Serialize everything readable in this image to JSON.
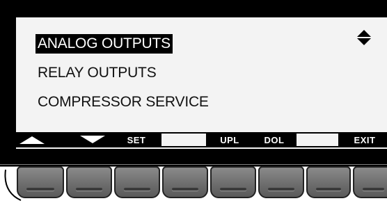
{
  "menu": {
    "items": [
      {
        "label": "ANALOG OUTPUTS",
        "selected": true
      },
      {
        "label": "RELAY OUTPUTS",
        "selected": false
      },
      {
        "label": "COMPRESSOR SERVICE",
        "selected": false
      }
    ],
    "scroll_icon": "up-down-triangles-icon"
  },
  "softkeys": {
    "up_icon": "triangle-up-icon",
    "down_icon": "triangle-down-icon",
    "set": "SET",
    "upl": "UPL",
    "dol": "DOL",
    "exit": "EXIT"
  },
  "colors": {
    "bezel": "#000000",
    "screen": "#f3f3f3",
    "selection": "#000000",
    "button_gray": "#6e6e6e"
  }
}
